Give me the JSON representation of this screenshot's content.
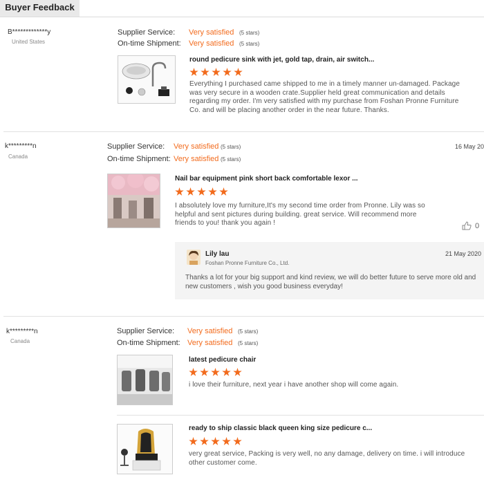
{
  "tab": {
    "label": "Buyer Feedback"
  },
  "rating_label": "Very satisfied",
  "stars_text": "(5 stars)",
  "labels": {
    "supplier_service": "Supplier Service:",
    "ontime_shipment": "On-time Shipment:"
  },
  "reviews": [
    {
      "buyer": "B*************y",
      "country": "United States",
      "date": "",
      "products": [
        {
          "title": "round pedicure sink with jet, gold tap, drain, air switch...",
          "text": "Everything I purchased came shipped to me in a timely manner un-damaged. Package was very secure in a wooden crate.Supplier held great communication and details regarding my order. I'm very satisfied with my purchase from Foshan Pronne Furniture Co. and will be placing another order in the near future. Thanks."
        }
      ]
    },
    {
      "buyer": "k*********n",
      "country": "Canada",
      "date": "16 May 20",
      "helpful_count": "0",
      "products": [
        {
          "title": "Nail bar equipment pink short back comfortable lexor ...",
          "text": "I absolutely love my furniture,It's my second time order from Pronne. Lily was so helpful and sent pictures during building. great service. Will recommend more friends to you! thank you again !"
        }
      ],
      "reply": {
        "name": "Lily lau",
        "company": "Foshan Pronne Furniture Co., Ltd.",
        "date": "21 May 2020",
        "text": "Thanks a lot for your big support and kind review, we will do better future to serve more old and new customers , wish you good business everyday!"
      }
    },
    {
      "buyer": "k*********n",
      "country": "Canada",
      "date": "",
      "products": [
        {
          "title": "latest pedicure chair",
          "text": "i love their furniture, next year i have another shop will come again."
        },
        {
          "title": "ready to ship classic black queen king size pedicure c...",
          "text": "very great service, Packing is very well, no any damage, delivery on time. i will introduce other customer come."
        }
      ]
    }
  ]
}
